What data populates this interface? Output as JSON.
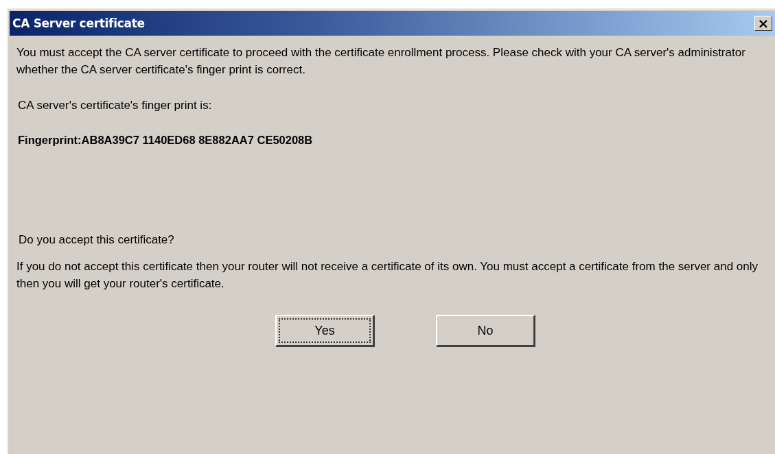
{
  "window": {
    "title": "CA Server certificate",
    "close": "×"
  },
  "message": [
    "You must accept the CA server certificate to proceed with the certificate enrollment process. Please check with your CA server's administrator whether the CA server certificate's finger print is correct."
  ],
  "fingerprint_label": "CA server's certificate's finger print is:",
  "fingerprint": "Fingerprint:AB8A39C7 1140ED68 8E882AA7 CE50208B",
  "question": "Do you accept this certificate?",
  "note": "If you do not accept this certificate then your router will not receive a certificate of its own. You must accept a certificate from the server and only then you will get your router's certificate.",
  "buttons": [
    {
      "label": "Yes",
      "focused": true
    },
    {
      "label": "No",
      "focused": false
    }
  ]
}
